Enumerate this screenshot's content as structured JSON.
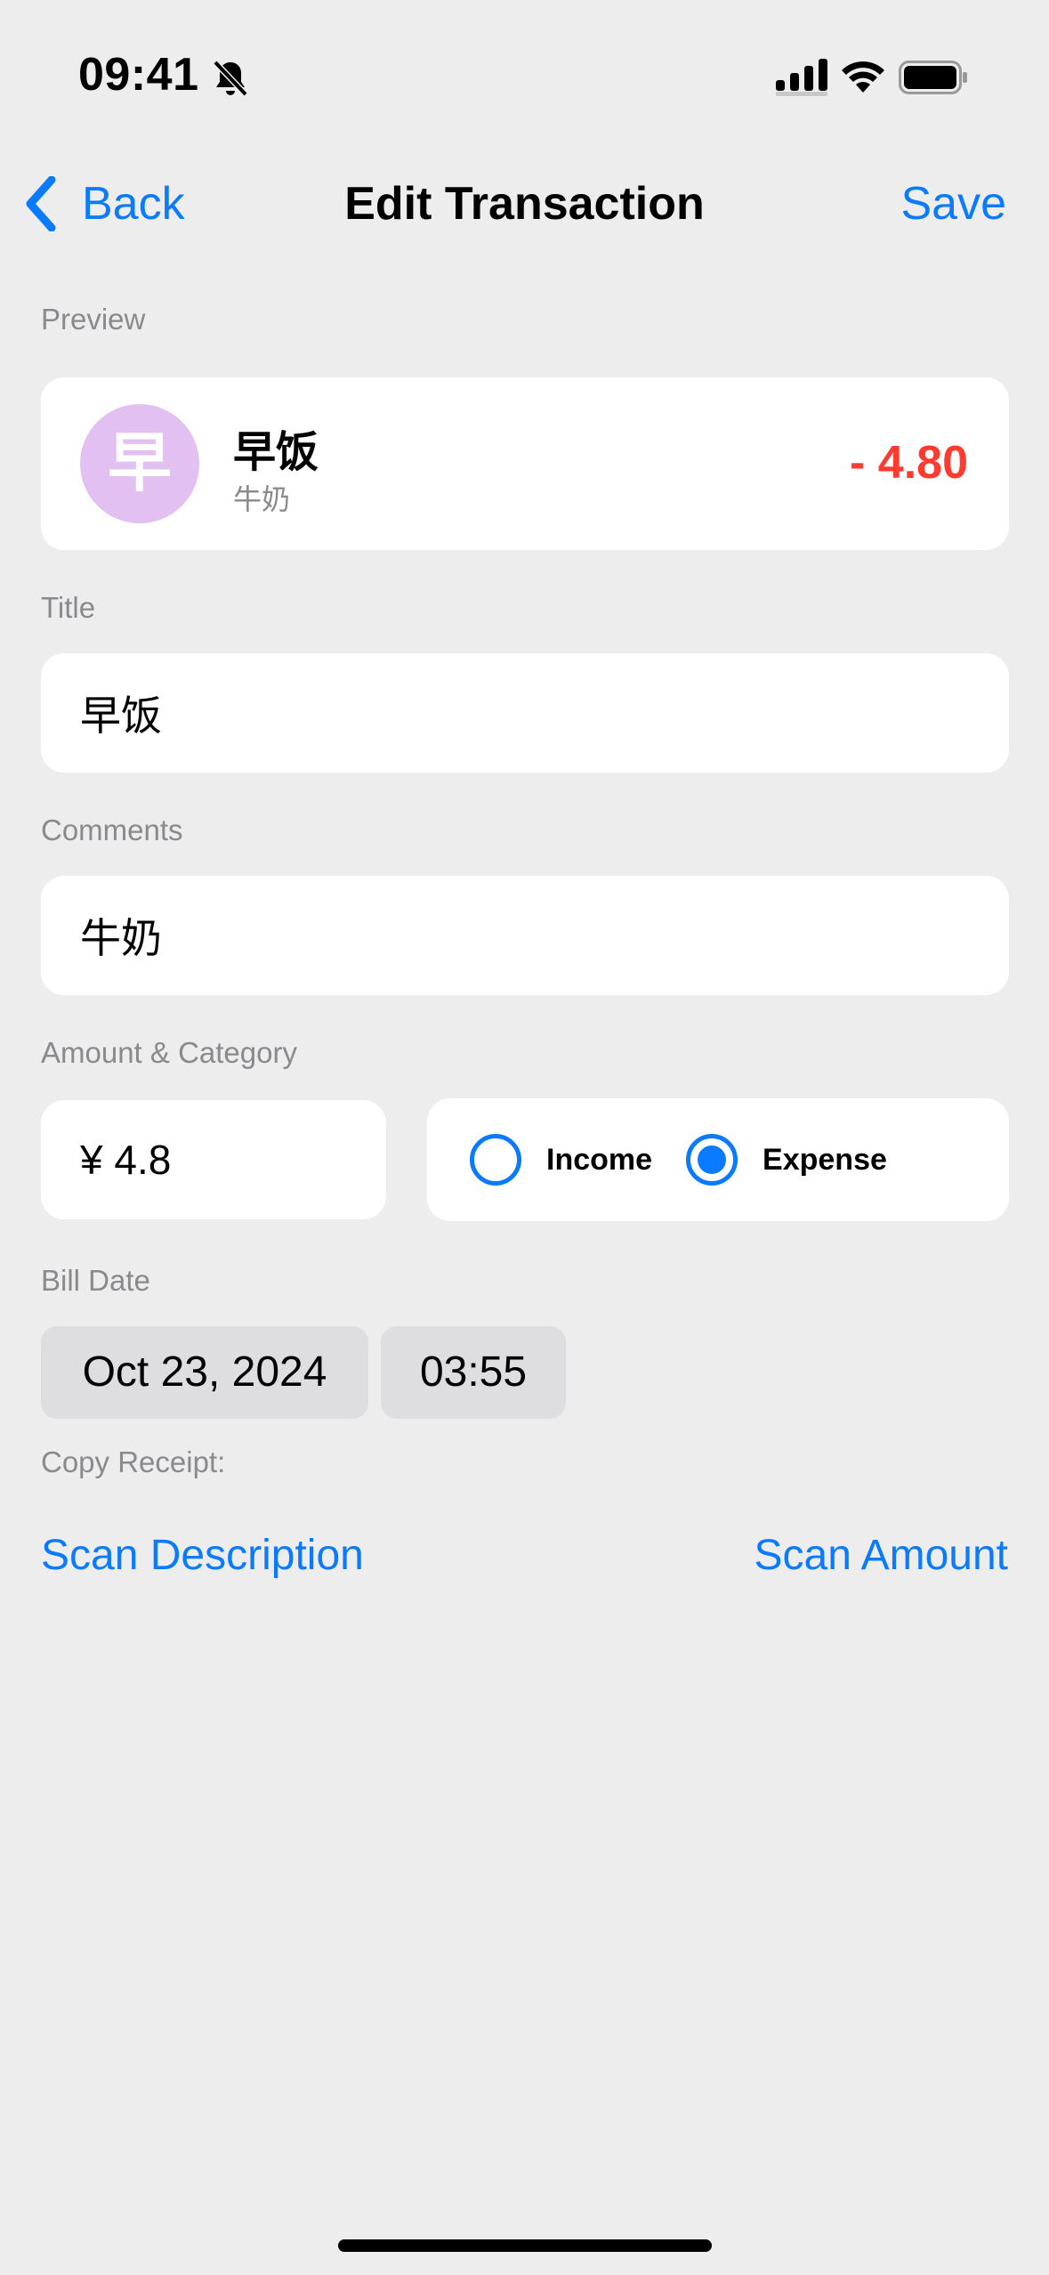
{
  "status_bar": {
    "time": "09:41",
    "icons": [
      "bell-slash-icon",
      "cellular-signal-icon",
      "wifi-icon",
      "battery-icon"
    ]
  },
  "nav": {
    "back_label": "Back",
    "title": "Edit Transaction",
    "save_label": "Save"
  },
  "preview": {
    "section_label": "Preview",
    "avatar_char": "早",
    "avatar_color": "#e3c0f2",
    "title": "早饭",
    "subtitle": "牛奶",
    "amount": "- 4.80",
    "amount_color": "#ff3b30"
  },
  "title_field": {
    "label": "Title",
    "value": "早饭"
  },
  "comments_field": {
    "label": "Comments",
    "value": "牛奶"
  },
  "amount_category": {
    "label": "Amount & Category",
    "amount_value": "¥ 4.8",
    "options": [
      {
        "label": "Income",
        "selected": false
      },
      {
        "label": "Expense",
        "selected": true
      }
    ]
  },
  "bill_date": {
    "label": "Bill Date",
    "date": "Oct 23, 2024",
    "time": "03:55"
  },
  "copy_receipt": {
    "label": "Copy Receipt:",
    "scan_description": "Scan Description",
    "scan_amount": "Scan Amount"
  },
  "colors": {
    "accent": "#0a7aff",
    "background": "#ededed",
    "expense": "#ff3b30"
  }
}
